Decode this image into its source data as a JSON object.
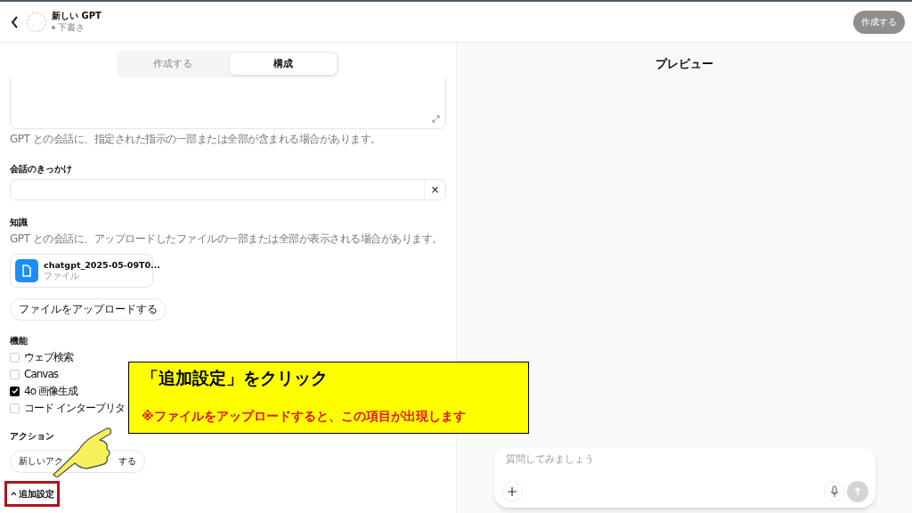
{
  "header": {
    "title": "新しい GPT",
    "status": "下書き",
    "create_button": "作成する"
  },
  "tabs": [
    {
      "label": "作成する",
      "selected": false
    },
    {
      "label": "構成",
      "selected": true
    }
  ],
  "instructions": {
    "caption": "GPT との会話に、指定された指示の一部または全部が含まれる場合があります。"
  },
  "conversation_starters": {
    "label": "会話のきっかけ",
    "clear": "×"
  },
  "knowledge": {
    "label": "知識",
    "caption": "GPT との会話に、アップロードしたファイルの一部または全部が表示される場合があります。",
    "file": {
      "name": "chatgpt_2025-05-09T0...",
      "type": "ファイル"
    },
    "upload_button": "ファイルをアップロードする"
  },
  "capabilities": {
    "label": "機能",
    "items": [
      {
        "label": "ウェブ検索",
        "checked": false
      },
      {
        "label": "Canvas",
        "checked": false
      },
      {
        "label": "4o 画像生成",
        "checked": true
      },
      {
        "label": "コード インタープリタ",
        "checked": false
      }
    ]
  },
  "actions": {
    "label": "アクション",
    "button_start": "新しいアク",
    "button_end": "する"
  },
  "advanced": {
    "label": "追加設定",
    "expanded": true
  },
  "preview": {
    "title": "プレビュー",
    "placeholder": "質問してみましょう"
  },
  "callout": {
    "title": "「追加設定」をクリック",
    "note": "※ファイルをアップロードすると、この項目が出現します"
  }
}
